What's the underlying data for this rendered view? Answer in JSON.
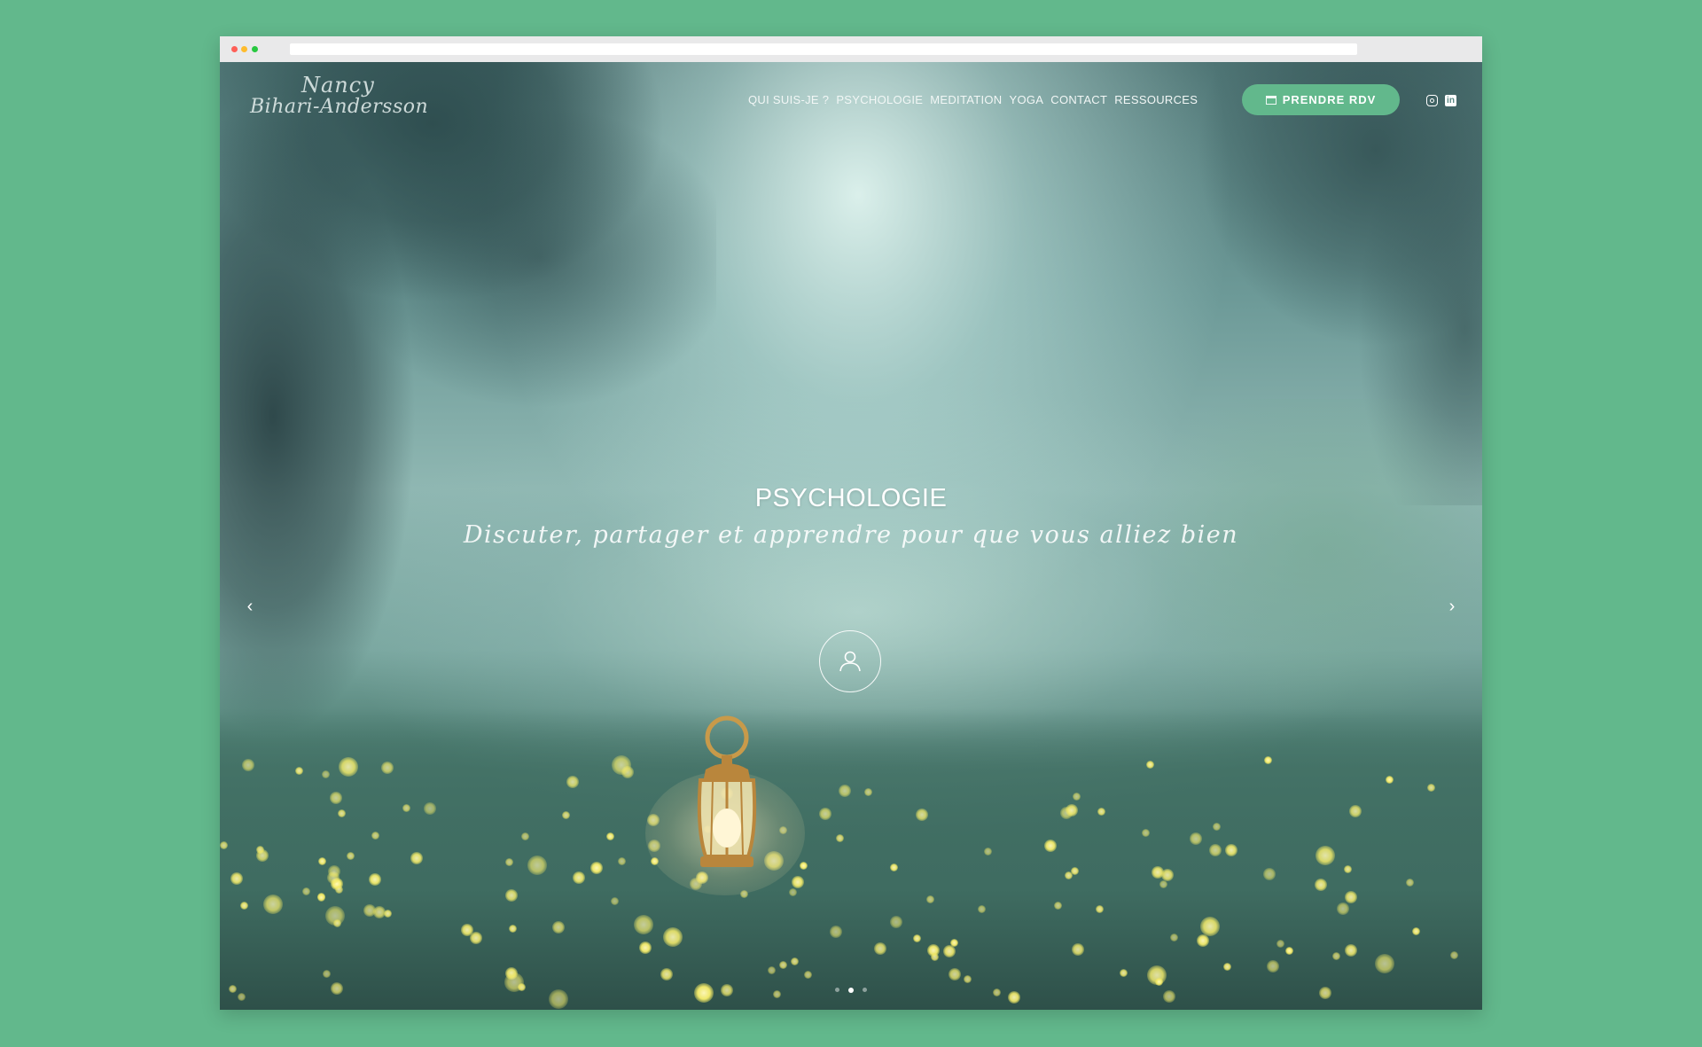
{
  "logo": {
    "line1": "Nancy",
    "line2": "Bihari-Andersson"
  },
  "nav": {
    "items": [
      {
        "label": "QUI SUIS-JE ?"
      },
      {
        "label": "PSYCHOLOGIE"
      },
      {
        "label": "MEDITATION"
      },
      {
        "label": "YOGA"
      },
      {
        "label": "CONTACT"
      },
      {
        "label": "RESSOURCES"
      }
    ]
  },
  "cta": {
    "label": "PRENDRE RDV",
    "icon": "calendar-icon"
  },
  "social": {
    "instagram": "instagram-icon",
    "linkedin": "linkedin-icon",
    "linkedin_glyph": "in"
  },
  "hero": {
    "title": "PSYCHOLOGIE",
    "subtitle": "Discuter, partager et apprendre pour que vous alliez bien",
    "icon": "user-icon",
    "prev_glyph": "‹",
    "next_glyph": "›"
  },
  "slider": {
    "slide_count": 3,
    "active_slide": 2
  },
  "colors": {
    "accent": "#62b88c",
    "page_background": "#62b88c",
    "firefly": "#f2ea6a"
  }
}
